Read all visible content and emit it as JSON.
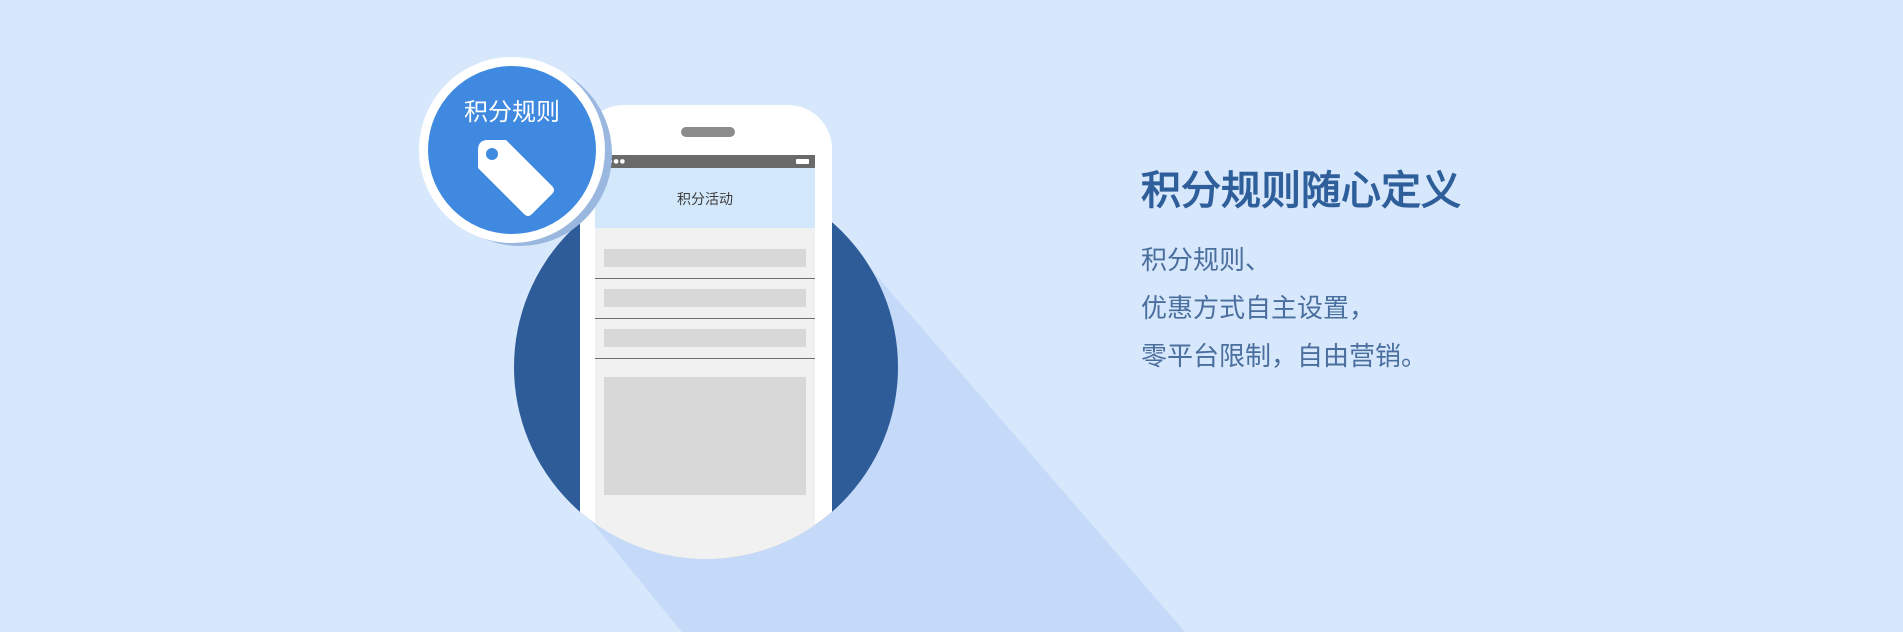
{
  "badge": {
    "label": "积分规则",
    "icon": "tag-icon"
  },
  "phone": {
    "screen_title": "积分活动"
  },
  "copy": {
    "headline": "积分规则随心定义",
    "lines": [
      "积分规则、",
      "优惠方式自主设置，",
      "零平台限制，自由营销。"
    ]
  },
  "colors": {
    "background": "#d8e8fc",
    "circle": "#2e5c98",
    "badge": "#3f8ae0",
    "headline": "#2f5f9a",
    "body_text": "#4a6e9d"
  }
}
